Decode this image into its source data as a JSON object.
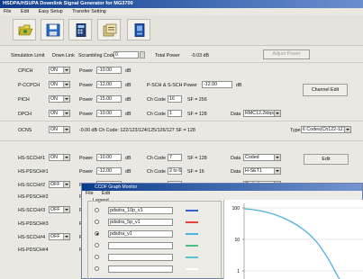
{
  "app": {
    "title": "HSDPA/HSUPA Downlink Signal Generator for MG3700",
    "menu": [
      "File",
      "Edit",
      "Easy Setup",
      "Transfer Setting"
    ]
  },
  "toolbar": {
    "icons": [
      "open-folder-icon",
      "save-disk-icon",
      "calculator-icon",
      "export-icon",
      "transfer-icon"
    ]
  },
  "top_row": {
    "sim_limit_label": "Simulation Limit",
    "down_link_label": "Down Link",
    "scrambling_label": "Scrambling Code",
    "scrambling_value": "0",
    "total_power_label": "Total Power",
    "total_power_value": "-0.03 dB",
    "adjust_button": "Adjust Power"
  },
  "channels": {
    "cpich": {
      "name": "CPICH",
      "state": "ON",
      "power_label": "Power",
      "power": "-10.00",
      "unit": "dB"
    },
    "pccpch": {
      "name": "P-CCPCH",
      "state": "ON",
      "power_label": "Power",
      "power": "-12.00",
      "unit": "dB",
      "sch_label": "P-SCH & S-SCH Power",
      "sch_power": "-12.00",
      "sch_unit": "dB"
    },
    "pich": {
      "name": "PICH",
      "state": "ON",
      "power_label": "Power",
      "power": "-15.00",
      "unit": "dB",
      "ch_label": "Ch Code",
      "ch_code": "16",
      "sf_label": "SF = 256"
    },
    "dpch": {
      "name": "DPCH",
      "state": "ON",
      "power_label": "Power",
      "power": "-10.00",
      "unit": "dB",
      "ch_label": "Ch Code",
      "ch_code": "1",
      "sf_label": "SF = 128",
      "data_label": "Data",
      "data_value": "RMC12.2kbps"
    },
    "channel_edit": "Channel Edit"
  },
  "ocns": {
    "name": "OCNS",
    "state": "ON",
    "text": "-0.00 dB  Ch Code: 122/123/124/125/126/127  SF = 128",
    "type_label": "Type",
    "type_value": "6 Codes(Ch122-127)"
  },
  "hs_rows": [
    {
      "name": "HS-SCCH#1",
      "state": "ON",
      "power_label": "Power",
      "power": "-10.00",
      "unit": "dB",
      "ch_label": "Ch Code",
      "ch_code": "7",
      "sf": "SF = 128",
      "data_label": "Data",
      "data_value": "Coded"
    },
    {
      "name": "HS-PDSCH#1",
      "state": "",
      "power_label": "Power",
      "power": "-12.00",
      "unit": "dB",
      "ch_label": "Ch Code",
      "ch_code": "2 to 6",
      "sf": "SF = 16",
      "data_label": "Data",
      "data_value": "H-SET1"
    },
    {
      "name": "HS-SCCH#2",
      "state": "OFF",
      "power_label": "Power",
      "power": "",
      "unit": "",
      "ch_label": "Ch Code",
      "ch_code": "",
      "sf": "SF = 128",
      "data_label": "Data",
      "data_value": "Coded"
    },
    {
      "name": "HS-PDSCH#2",
      "state": "",
      "power_label": "Po",
      "power": "",
      "unit": "",
      "ch_label": "",
      "ch_code": "",
      "sf": "",
      "data_label": "",
      "data_value": ""
    },
    {
      "name": "HS-SCCH#3",
      "state": "OFF",
      "power_label": "Po",
      "power": "",
      "unit": "",
      "ch_label": "",
      "ch_code": "",
      "sf": "",
      "data_label": "",
      "data_value": ""
    },
    {
      "name": "HS-PDSCH#3",
      "state": "",
      "power_label": "Po",
      "power": "",
      "unit": "",
      "ch_label": "",
      "ch_code": "",
      "sf": "",
      "data_label": "",
      "data_value": ""
    },
    {
      "name": "HS-SCCH#4",
      "state": "OFF",
      "power_label": "Po",
      "power": "",
      "unit": "",
      "ch_label": "",
      "ch_code": "",
      "sf": "",
      "data_label": "",
      "data_value": ""
    },
    {
      "name": "HS-PDSCH#4",
      "state": "",
      "power_label": "Po",
      "power": "",
      "unit": "",
      "ch_label": "",
      "ch_code": "",
      "sf": "",
      "data_label": "",
      "data_value": ""
    }
  ],
  "hs_edit_button": "Edit",
  "graph": {
    "title": "CCDF Graph Monitor",
    "menu": [
      "File",
      "Edit"
    ],
    "legend_title": "Legend",
    "entries": [
      {
        "label": "pdsdra_10p_v1",
        "color": "#3a5fd0",
        "selected": false
      },
      {
        "label": "pdsdra_5p_v1",
        "color": "#e0443a",
        "selected": false
      },
      {
        "label": "pdsdra_v1",
        "color": "#4fb3d9",
        "selected": true
      },
      {
        "label": "",
        "color": "#4cc080",
        "selected": false
      },
      {
        "label": "",
        "color": "#53c7cf",
        "selected": false
      },
      {
        "label": "",
        "color": "#ffffff",
        "selected": false
      }
    ],
    "y_ticks": [
      "100",
      "10",
      "1"
    ]
  }
}
